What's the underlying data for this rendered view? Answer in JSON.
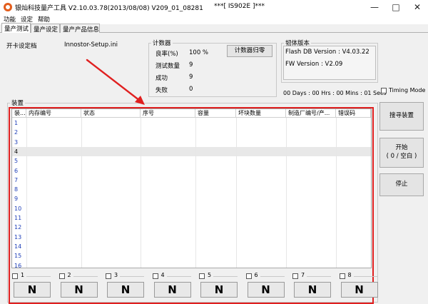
{
  "window": {
    "title": "银灿科技量产工具 V2.10.03.78(2013/08/08)     V209_01_08281",
    "title_center": "***[ IS902E ]***"
  },
  "menu": [
    "功能",
    "设定",
    "帮助"
  ],
  "tabs": [
    "量产测试",
    "量产设定",
    "量产产品信息"
  ],
  "config": {
    "label": "开卡设定档",
    "value": "Innostor-Setup.ini"
  },
  "counter": {
    "title": "计数器",
    "rows": [
      {
        "label": "良率(%)",
        "value": "100 %"
      },
      {
        "label": "测试数量",
        "value": "9"
      },
      {
        "label": "成功",
        "value": "9"
      },
      {
        "label": "失败",
        "value": "0"
      }
    ],
    "reset_label": "计数器归零"
  },
  "firmware": {
    "title": "韧体版本",
    "flash_db": "Flash DB Version :  V4.03.22",
    "fw": "FW Version :    V2.09"
  },
  "timer": "00 Days : 00 Hrs : 00 Mins : 01 Secs",
  "timing_mode_label": "Timing Mode",
  "devices_title": "装置",
  "columns": [
    "装...",
    "内存编号",
    "状态",
    "序号",
    "容量",
    "坏块数量",
    "制造厂编号/产...",
    "错误码"
  ],
  "rows": [
    "1",
    "2",
    "3",
    "4",
    "5",
    "6",
    "7",
    "8",
    "9",
    "10",
    "11",
    "12",
    "13",
    "14",
    "15",
    "16"
  ],
  "selected_row": 3,
  "buttons": {
    "search": "搜寻装置",
    "start": "开始",
    "start_sub": "( 0 / 空白 )",
    "stop": "停止"
  },
  "ports": [
    {
      "num": "1",
      "state": "N"
    },
    {
      "num": "2",
      "state": "N"
    },
    {
      "num": "3",
      "state": "N"
    },
    {
      "num": "4",
      "state": "N"
    },
    {
      "num": "5",
      "state": "N"
    },
    {
      "num": "6",
      "state": "N"
    },
    {
      "num": "7",
      "state": "N"
    },
    {
      "num": "8",
      "state": "N"
    }
  ],
  "colors": {
    "annotation": "#e02020",
    "row_number": "#1f3fb8",
    "app_icon": "#e35d1c"
  }
}
